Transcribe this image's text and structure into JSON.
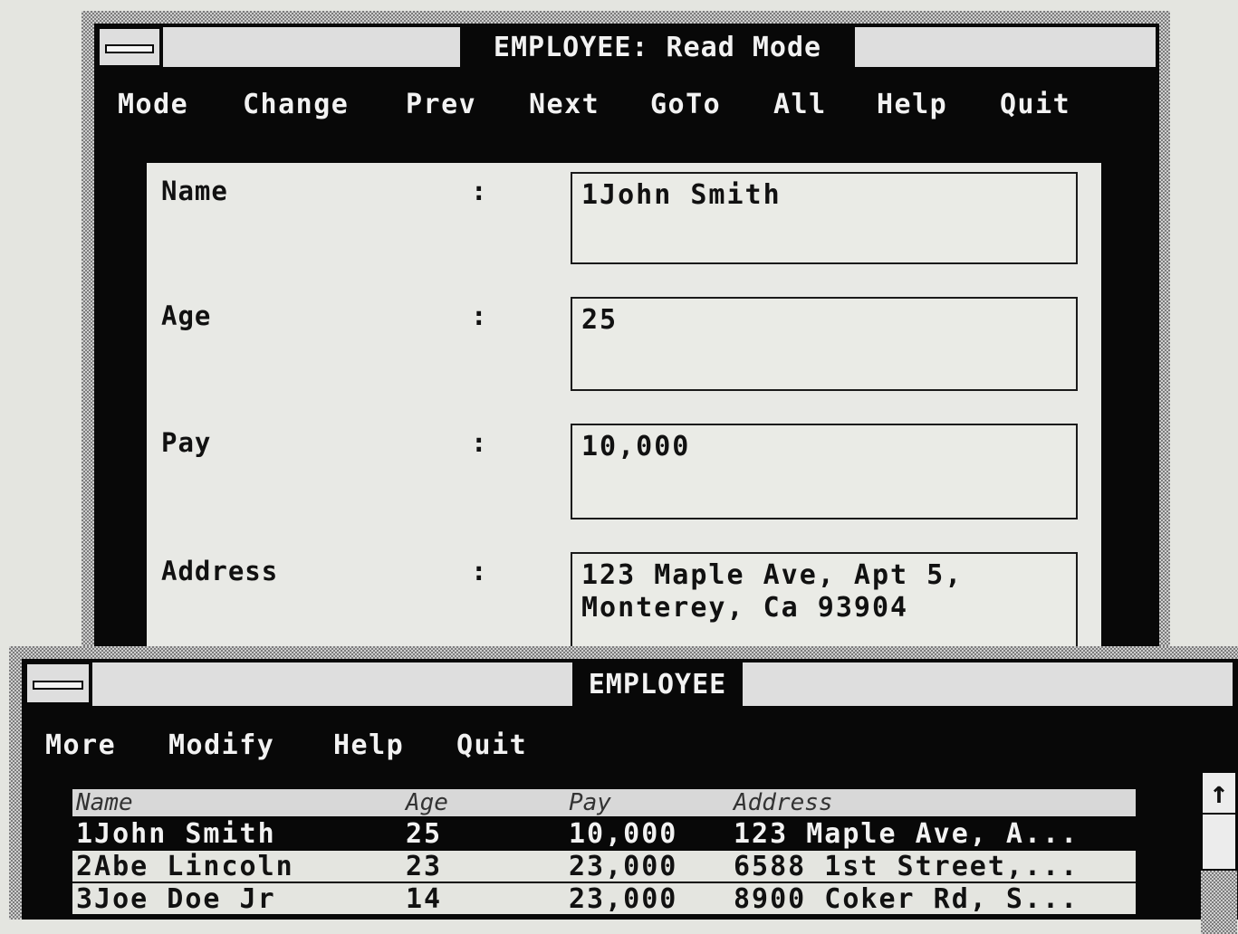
{
  "record_window": {
    "title": "EMPLOYEE: Read Mode",
    "menu": [
      "Mode",
      "Change",
      "Prev",
      "Next",
      "GoTo",
      "All",
      "Help",
      "Quit"
    ],
    "fields": [
      {
        "label": "Name",
        "colon": ":",
        "value": "1John Smith"
      },
      {
        "label": "Age",
        "colon": ":",
        "value": "25"
      },
      {
        "label": "Pay",
        "colon": ":",
        "value": "10,000"
      },
      {
        "label": "Address",
        "colon": ":",
        "value": "123 Maple Ave, Apt 5,\nMonterey, Ca 93904"
      }
    ]
  },
  "list_window": {
    "title": "EMPLOYEE",
    "menu": [
      "More",
      "Modify",
      "Help",
      "Quit"
    ],
    "columns": [
      "Name",
      "Age",
      "Pay",
      "Address"
    ],
    "rows": [
      {
        "name": "1John Smith",
        "age": "25",
        "pay": "10,000",
        "address": "123 Maple Ave, A...",
        "selected": true
      },
      {
        "name": "2Abe Lincoln",
        "age": "23",
        "pay": "23,000",
        "address": "6588 1st Street,...",
        "selected": false
      },
      {
        "name": "3Joe Doe Jr",
        "age": "14",
        "pay": "23,000",
        "address": "8900 Coker Rd, S...",
        "selected": false
      }
    ],
    "scrollbar": {
      "up_icon": "arrow-up-icon",
      "up_glyph": "↑"
    }
  }
}
